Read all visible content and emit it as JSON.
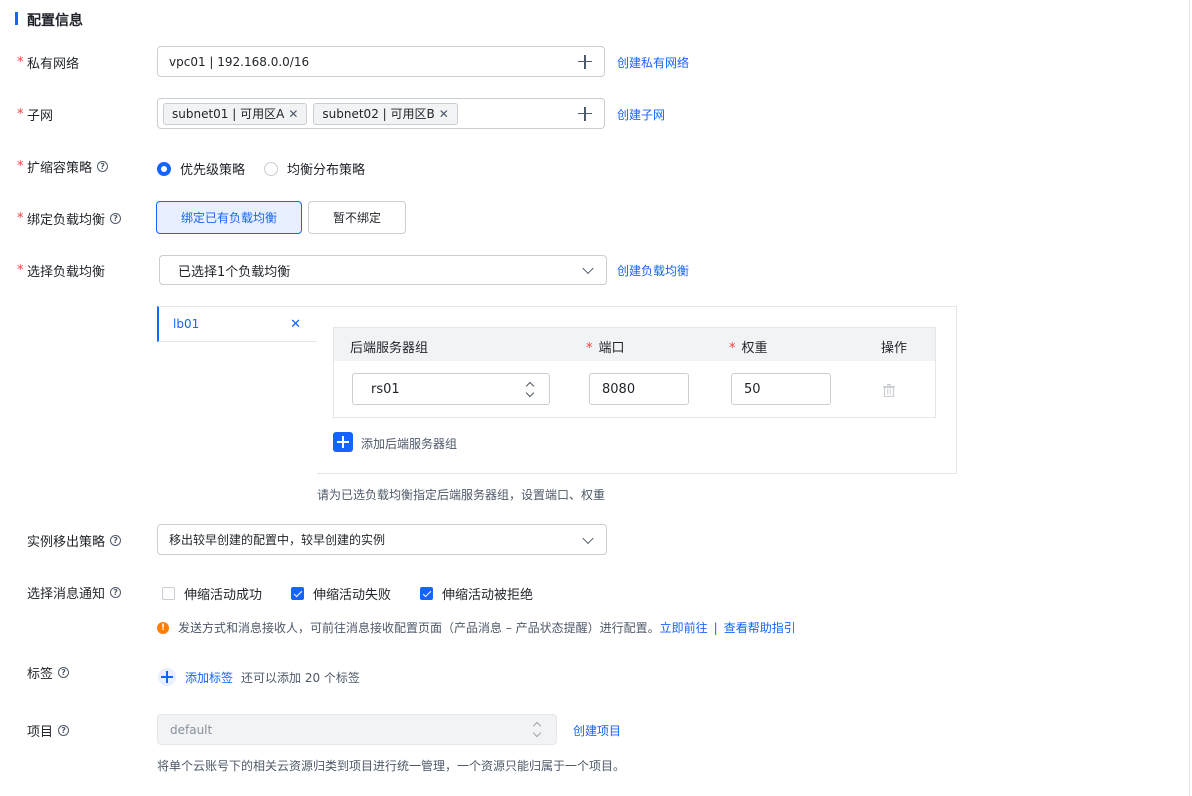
{
  "section": {
    "title": "配置信息"
  },
  "vpc": {
    "label": "私有网络",
    "value": "vpc01 | 192.168.0.0/16",
    "link": "创建私有网络"
  },
  "subnet": {
    "label": "子网",
    "tags": [
      "subnet01 | 可用区A",
      "subnet02 | 可用区B"
    ],
    "link": "创建子网"
  },
  "scaling": {
    "label": "扩缩容策略",
    "options": [
      "优先级策略",
      "均衡分布策略"
    ],
    "selected": "优先级策略"
  },
  "bind_lb": {
    "label": "绑定负载均衡",
    "options": [
      "绑定已有负载均衡",
      "暂不绑定"
    ],
    "selected": "绑定已有负载均衡"
  },
  "select_lb": {
    "label": "选择负载均衡",
    "value": "已选择1个负载均衡",
    "link": "创建负载均衡"
  },
  "lb_panel": {
    "tab": "lb01",
    "headers": {
      "group": "后端服务器组",
      "port": "端口",
      "weight": "权重",
      "action": "操作"
    },
    "row": {
      "group": "rs01",
      "port": "8080",
      "weight": "50"
    },
    "add_label": "添加后端服务器组",
    "hint": "请为已选负载均衡指定后端服务器组，设置端口、权重"
  },
  "removal": {
    "label": "实例移出策略",
    "value": "移出较早创建的配置中，较早创建的实例"
  },
  "notify": {
    "label": "选择消息通知",
    "options": [
      {
        "text": "伸缩活动成功",
        "checked": false
      },
      {
        "text": "伸缩活动失败",
        "checked": true
      },
      {
        "text": "伸缩活动被拒绝",
        "checked": true
      }
    ],
    "info": "发送方式和消息接收人，可前往消息接收配置页面（产品消息 – 产品状态提醒）进行配置。",
    "link1": "立即前往",
    "sep": "|",
    "link2": "查看帮助指引"
  },
  "tags": {
    "label": "标签",
    "add": "添加标签",
    "remaining": "还可以添加 20 个标签"
  },
  "project": {
    "label": "项目",
    "value": "default",
    "link": "创建项目",
    "hint": "将单个云账号下的相关云资源归类到项目进行统一管理，一个资源只能归属于一个项目。"
  },
  "icons": {
    "help": "?",
    "close": "✕",
    "warning": "!",
    "req": "*"
  }
}
